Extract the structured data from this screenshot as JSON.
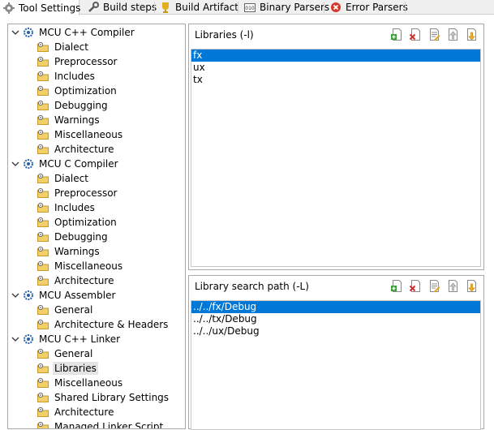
{
  "tabs": [
    {
      "label": "Tool Settings",
      "icon": "gear-icon",
      "active": true
    },
    {
      "label": "Build steps",
      "icon": "wrench-icon",
      "active": false
    },
    {
      "label": "Build Artifact",
      "icon": "trophy-icon",
      "active": false
    },
    {
      "label": "Binary Parsers",
      "icon": "binary-icon",
      "active": false
    },
    {
      "label": "Error Parsers",
      "icon": "error-icon",
      "active": false
    }
  ],
  "tree": [
    {
      "label": "MCU C++ Compiler",
      "level": 0,
      "expanded": true
    },
    {
      "label": "Dialect",
      "level": 1
    },
    {
      "label": "Preprocessor",
      "level": 1
    },
    {
      "label": "Includes",
      "level": 1
    },
    {
      "label": "Optimization",
      "level": 1
    },
    {
      "label": "Debugging",
      "level": 1
    },
    {
      "label": "Warnings",
      "level": 1
    },
    {
      "label": "Miscellaneous",
      "level": 1
    },
    {
      "label": "Architecture",
      "level": 1
    },
    {
      "label": "MCU C Compiler",
      "level": 0,
      "expanded": true
    },
    {
      "label": "Dialect",
      "level": 1
    },
    {
      "label": "Preprocessor",
      "level": 1
    },
    {
      "label": "Includes",
      "level": 1
    },
    {
      "label": "Optimization",
      "level": 1
    },
    {
      "label": "Debugging",
      "level": 1
    },
    {
      "label": "Warnings",
      "level": 1
    },
    {
      "label": "Miscellaneous",
      "level": 1
    },
    {
      "label": "Architecture",
      "level": 1
    },
    {
      "label": "MCU Assembler",
      "level": 0,
      "expanded": true
    },
    {
      "label": "General",
      "level": 1
    },
    {
      "label": "Architecture & Headers",
      "level": 1
    },
    {
      "label": "MCU C++ Linker",
      "level": 0,
      "expanded": true
    },
    {
      "label": "General",
      "level": 1
    },
    {
      "label": "Libraries",
      "level": 1,
      "selected": true
    },
    {
      "label": "Miscellaneous",
      "level": 1
    },
    {
      "label": "Shared Library Settings",
      "level": 1
    },
    {
      "label": "Architecture",
      "level": 1
    },
    {
      "label": "Managed Linker Script",
      "level": 1
    }
  ],
  "libraries": {
    "title": "Libraries (-l)",
    "items": [
      "fx",
      "ux",
      "tx"
    ],
    "selected_index": 0
  },
  "search_paths": {
    "title": "Library search path (-L)",
    "items": [
      "../../fx/Debug",
      "../../tx/Debug",
      "../../ux/Debug"
    ],
    "selected_index": 0
  },
  "toolbar_buttons": [
    "add-icon",
    "delete-icon",
    "edit-icon",
    "move-up-icon",
    "move-down-icon"
  ],
  "colors": {
    "selection": "#0078d7",
    "tree_selection": "#e4e4e4",
    "border": "#a9a9a9"
  }
}
